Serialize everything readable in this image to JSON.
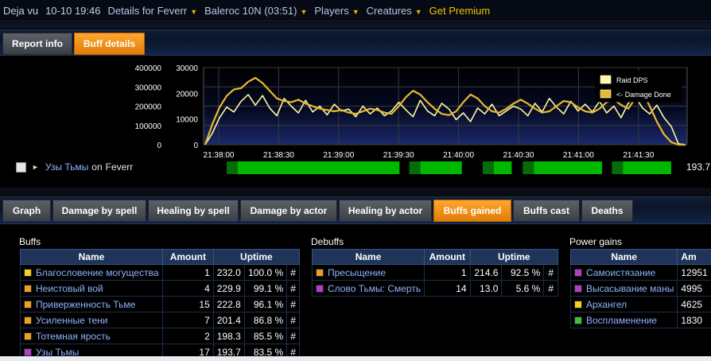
{
  "topbar": {
    "title": "Deja vu",
    "date": "10-10 19:46",
    "report": "Details for Feverr",
    "encounter": "Baleroc 10N (03:51)",
    "players": "Players",
    "creatures": "Creatures",
    "premium": "Get Premium"
  },
  "report_tabs": [
    {
      "label": "Report info",
      "active": false
    },
    {
      "label": "Buff details",
      "active": true
    }
  ],
  "chart_data": {
    "type": "line",
    "x_ticks": [
      "21:38:00",
      "21:38:30",
      "21:39:00",
      "21:39:30",
      "21:40:00",
      "21:40:30",
      "21:41:00",
      "21:41:30"
    ],
    "y_left_ticks": [
      "400000",
      "300000",
      "200000",
      "100000",
      "0"
    ],
    "y_right_ticks": [
      "30000",
      "20000",
      "10000",
      "0"
    ],
    "legend": [
      "Raid DPS",
      "<- Damage Done"
    ],
    "series_colors": [
      "#fff7a8",
      "#e8b92e"
    ],
    "series": [
      {
        "name": "Raid DPS",
        "axis": "left",
        "values": [
          0,
          60000,
          140000,
          195000,
          170000,
          225000,
          260000,
          205000,
          255000,
          190000,
          150000,
          240000,
          200000,
          165000,
          230000,
          170000,
          200000,
          155000,
          210000,
          175000,
          185000,
          145000,
          200000,
          160000,
          190000,
          150000,
          175000,
          220000,
          180000,
          145000,
          230000,
          175000,
          150000,
          215000,
          185000,
          130000,
          165000,
          120000,
          190000,
          160000,
          210000,
          150000,
          175000,
          200000,
          185000,
          150000,
          215000,
          170000,
          240000,
          195000,
          160000,
          225000,
          175000,
          210000,
          170000,
          225000,
          165000,
          200000,
          140000,
          215000,
          250000,
          190000,
          160000,
          205000,
          140000,
          95000,
          5000,
          0
        ]
      },
      {
        "name": "<- Damage Done",
        "axis": "right",
        "values": [
          0,
          8000,
          14500,
          19000,
          21500,
          22000,
          24500,
          26000,
          24000,
          21000,
          18000,
          17000,
          16500,
          17500,
          16000,
          15000,
          14000,
          13500,
          13000,
          13500,
          12500,
          12000,
          13000,
          14000,
          13500,
          12500,
          12000,
          15000,
          18500,
          21000,
          19500,
          16500,
          14000,
          12000,
          11500,
          13000,
          16500,
          19500,
          18000,
          15000,
          13000,
          12500,
          14000,
          16000,
          17500,
          16000,
          14000,
          12500,
          13000,
          15000,
          17000,
          16500,
          14500,
          13000,
          12500,
          14000,
          16500,
          17500,
          15500,
          14000,
          18000,
          20500,
          15000,
          9000,
          4000,
          1000,
          0,
          0
        ]
      }
    ]
  },
  "buff_row": {
    "link": "Узы Тьмы",
    "on": "on",
    "target": "Feverr",
    "uptime_value": "193.7",
    "uptime_bar_color": "#00b800",
    "uptime_segments": [
      {
        "start": 0.0,
        "end": 0.388,
        "shade": "mid"
      },
      {
        "start": 0.41,
        "end": 0.528,
        "shade": "mid"
      },
      {
        "start": 0.575,
        "end": 0.64,
        "shade": "mid"
      },
      {
        "start": 0.665,
        "end": 0.843,
        "shade": "mid"
      },
      {
        "start": 0.865,
        "end": 0.998,
        "shade": "mid"
      }
    ]
  },
  "section_tabs": [
    {
      "label": "Graph",
      "active": false
    },
    {
      "label": "Damage by spell",
      "active": false
    },
    {
      "label": "Healing by spell",
      "active": false
    },
    {
      "label": "Damage by actor",
      "active": false
    },
    {
      "label": "Healing by actor",
      "active": false
    },
    {
      "label": "Buffs gained",
      "active": true
    },
    {
      "label": "Buffs cast",
      "active": false
    },
    {
      "label": "Deaths",
      "active": false
    }
  ],
  "buffs": {
    "title": "Buffs",
    "headers": [
      "Name",
      "Amount",
      "Uptime"
    ],
    "rows": [
      {
        "name": "Благословение могущества",
        "color": "#f2d21a",
        "amount": "1",
        "uptime": "232.0",
        "pct": "100.0 %"
      },
      {
        "name": "Неистовый вой",
        "color": "#f0a020",
        "amount": "4",
        "uptime": "229.9",
        "pct": "99.1 %"
      },
      {
        "name": "Приверженность Тьме",
        "color": "#f0a020",
        "amount": "15",
        "uptime": "222.8",
        "pct": "96.1 %"
      },
      {
        "name": "Усиленные тени",
        "color": "#f0a020",
        "amount": "7",
        "uptime": "201.4",
        "pct": "86.8 %"
      },
      {
        "name": "Тотемная ярость",
        "color": "#f0a020",
        "amount": "2",
        "uptime": "198.3",
        "pct": "85.5 %"
      },
      {
        "name": "Узы Тьмы",
        "color": "#b040c0",
        "amount": "17",
        "uptime": "193.7",
        "pct": "83.5 %"
      }
    ]
  },
  "debuffs": {
    "title": "Debuffs",
    "headers": [
      "Name",
      "Amount",
      "Uptime"
    ],
    "rows": [
      {
        "name": "Пресыщение",
        "color": "#f0a020",
        "amount": "1",
        "uptime": "214.6",
        "pct": "92.5 %"
      },
      {
        "name": "Слово Тьмы: Смерть",
        "color": "#b040c0",
        "amount": "14",
        "uptime": "13.0",
        "pct": "5.6 %"
      }
    ]
  },
  "power_gains": {
    "title": "Power gains",
    "headers": [
      "Name",
      "Am"
    ],
    "rows": [
      {
        "name": "Самоистязание",
        "color": "#b040c0",
        "amount": "12951"
      },
      {
        "name": "Высасывание маны",
        "color": "#b040c0",
        "amount": "4995"
      },
      {
        "name": "Архангел",
        "color": "#f2d21a",
        "amount": "4625"
      },
      {
        "name": "Воспламенение",
        "color": "#40c040",
        "amount": "1830"
      }
    ]
  },
  "hash_symbol": "#"
}
